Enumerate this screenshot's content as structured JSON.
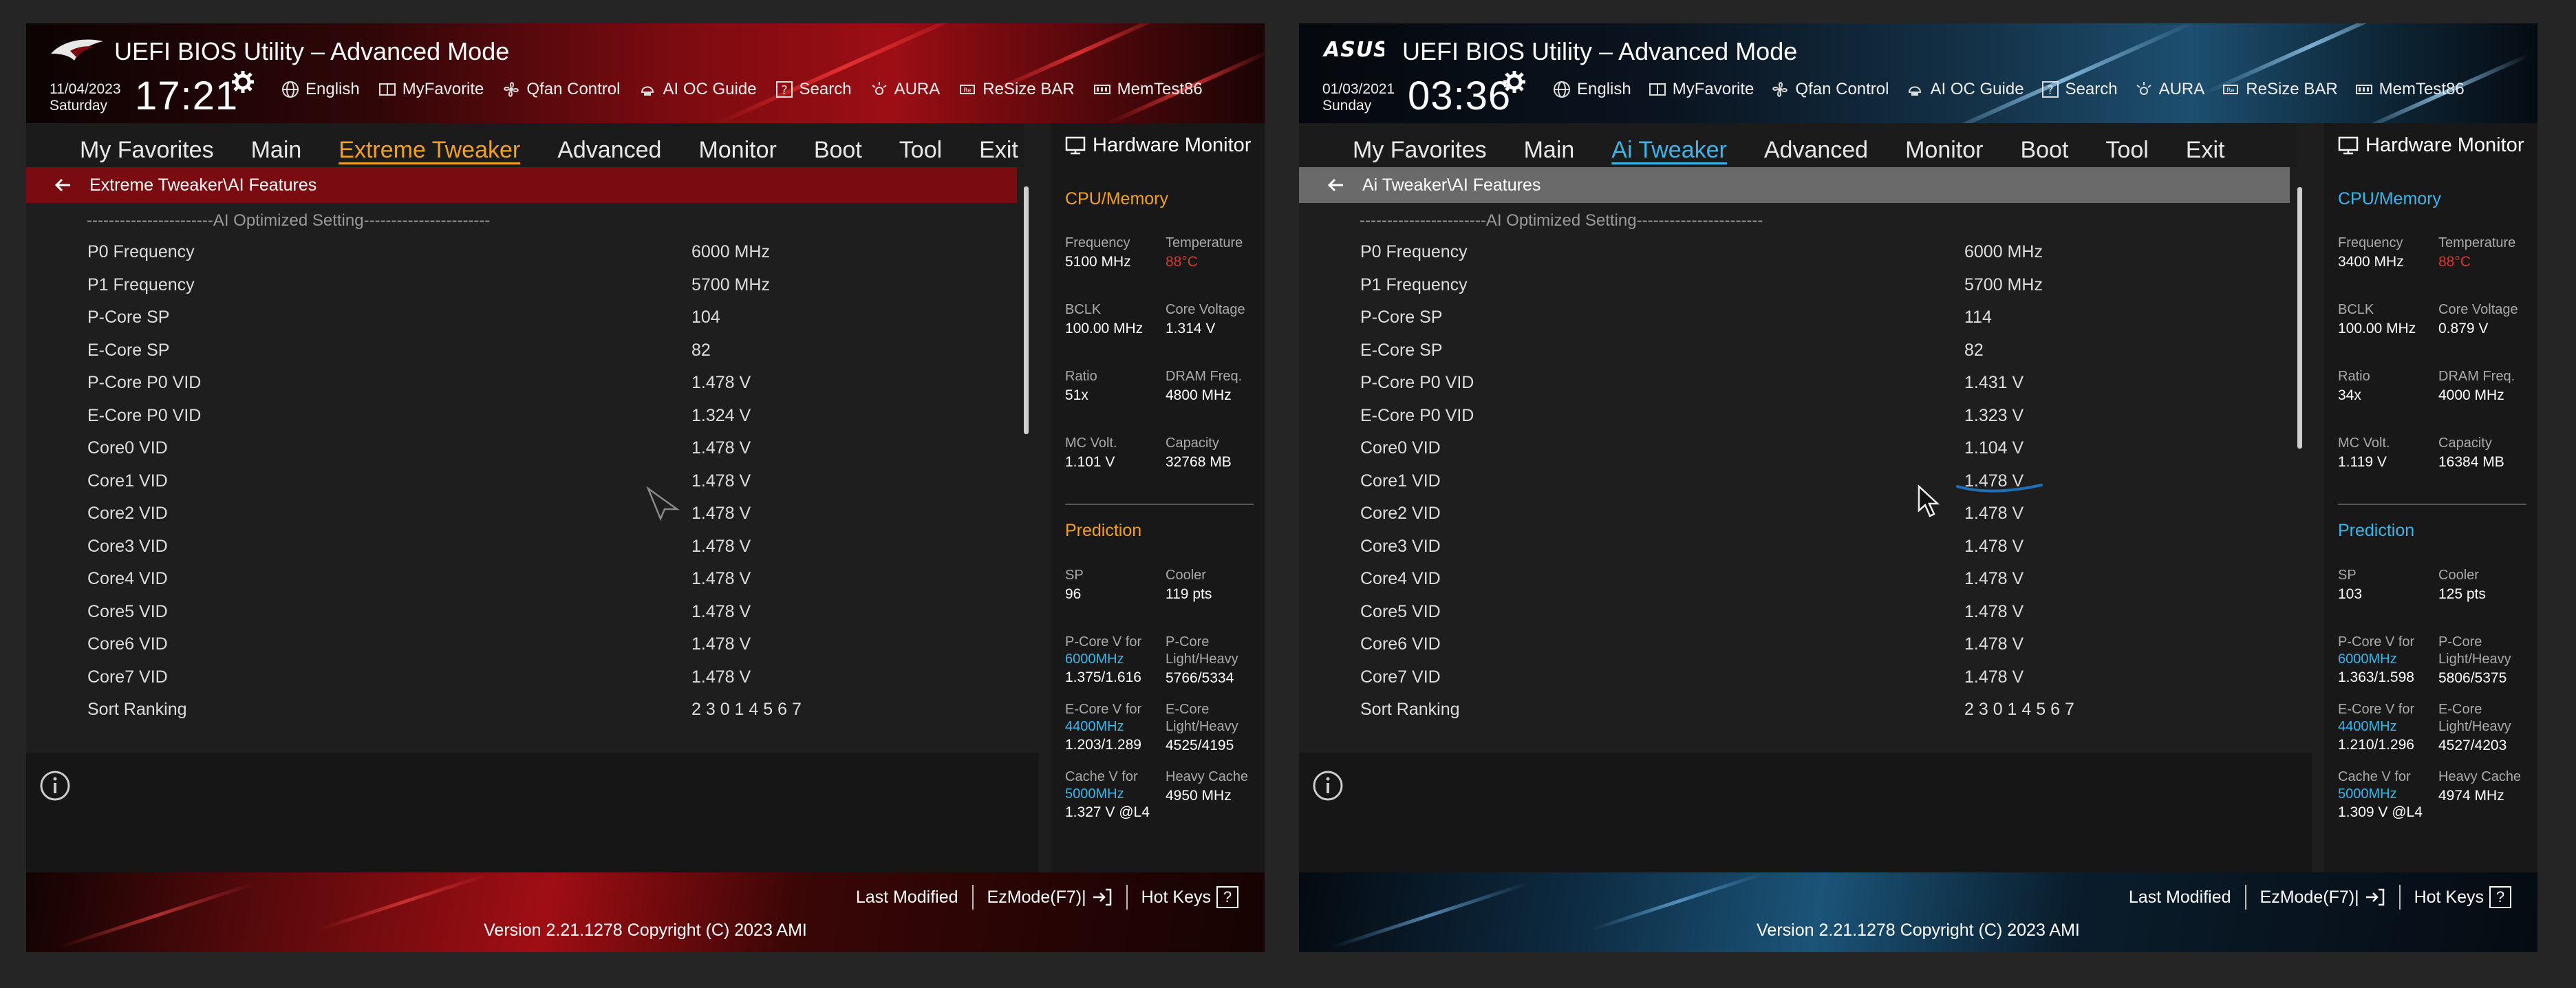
{
  "panels": [
    {
      "title": "UEFI BIOS Utility – Advanced Mode",
      "date": "11/04/2023",
      "day": "Saturday",
      "time": "17:21",
      "toolbar": [
        "English",
        "MyFavorite",
        "Qfan Control",
        "AI OC Guide",
        "Search",
        "AURA",
        "ReSize BAR",
        "MemTest86"
      ],
      "tabs": [
        "My Favorites",
        "Main",
        "Extreme Tweaker",
        "Advanced",
        "Monitor",
        "Boot",
        "Tool",
        "Exit"
      ],
      "active_tab": "Extreme Tweaker",
      "breadcrumb": "Extreme Tweaker\\AI Features",
      "divider": "-----------------------AI Optimized Setting-----------------------",
      "rows": [
        {
          "label": "P0 Frequency",
          "value": "6000 MHz"
        },
        {
          "label": "P1 Frequency",
          "value": "5700 MHz"
        },
        {
          "label": "P-Core SP",
          "value": "104"
        },
        {
          "label": "E-Core SP",
          "value": "82"
        },
        {
          "label": "P-Core P0 VID",
          "value": "1.478 V"
        },
        {
          "label": "E-Core P0 VID",
          "value": "1.324 V"
        },
        {
          "label": "Core0 VID",
          "value": "1.478 V"
        },
        {
          "label": "Core1 VID",
          "value": "1.478 V"
        },
        {
          "label": "Core2 VID",
          "value": "1.478 V"
        },
        {
          "label": "Core3 VID",
          "value": "1.478 V"
        },
        {
          "label": "Core4 VID",
          "value": "1.478 V"
        },
        {
          "label": "Core5 VID",
          "value": "1.478 V"
        },
        {
          "label": "Core6 VID",
          "value": "1.478 V"
        },
        {
          "label": "Core7 VID",
          "value": "1.478 V"
        },
        {
          "label": "Sort Ranking",
          "value": "2 3 0 1 4 5 6 7"
        }
      ],
      "hw_title": "Hardware Monitor",
      "hw_section_cpu": "CPU/Memory",
      "hw": {
        "frequency_label": "Frequency",
        "frequency": "5100 MHz",
        "temperature_label": "Temperature",
        "temperature": "88°C",
        "bclk_label": "BCLK",
        "bclk": "100.00 MHz",
        "core_voltage_label": "Core Voltage",
        "core_voltage": "1.314 V",
        "ratio_label": "Ratio",
        "ratio": "51x",
        "dram_label": "DRAM Freq.",
        "dram": "4800 MHz",
        "mc_volt_label": "MC Volt.",
        "mc_volt": "1.101 V",
        "capacity_label": "Capacity",
        "capacity": "32768 MB"
      },
      "hw_section_pred": "Prediction",
      "pred": {
        "sp_label": "SP",
        "sp": "96",
        "cooler_label": "Cooler",
        "cooler": "119 pts",
        "pcore_v_label": "P-Core V for",
        "pcore_v_freq": "6000MHz",
        "pcore_v": "1.375/1.616",
        "pcore_lh_label": "P-Core Light/Heavy",
        "pcore_lh": "5766/5334",
        "ecore_v_label": "E-Core V for",
        "ecore_v_freq": "4400MHz",
        "ecore_v": "1.203/1.289",
        "ecore_lh_label": "E-Core Light/Heavy",
        "ecore_lh": "4525/4195",
        "cache_v_label": "Cache V for",
        "cache_v_freq": "5000MHz",
        "cache_v": "1.327 V @L4",
        "heavy_cache_label": "Heavy Cache",
        "heavy_cache": "4950 MHz"
      },
      "footer": {
        "last_modified": "Last Modified",
        "ezmode": "EzMode(F7)|",
        "hotkeys": "Hot Keys",
        "hotkeys_key": "?",
        "version": "Version 2.21.1278 Copyright (C) 2023 AMI"
      },
      "accent": "#f2a11e",
      "theme": "red"
    },
    {
      "title": "UEFI BIOS Utility – Advanced Mode",
      "date": "01/03/2021",
      "day": "Sunday",
      "time": "03:36",
      "toolbar": [
        "English",
        "MyFavorite",
        "Qfan Control",
        "AI OC Guide",
        "Search",
        "AURA",
        "ReSize BAR",
        "MemTest86"
      ],
      "tabs": [
        "My Favorites",
        "Main",
        "Ai Tweaker",
        "Advanced",
        "Monitor",
        "Boot",
        "Tool",
        "Exit"
      ],
      "active_tab": "Ai Tweaker",
      "breadcrumb": "Ai Tweaker\\AI Features",
      "divider": "-----------------------AI Optimized Setting-----------------------",
      "rows": [
        {
          "label": "P0 Frequency",
          "value": "6000 MHz"
        },
        {
          "label": "P1 Frequency",
          "value": "5700 MHz"
        },
        {
          "label": "P-Core SP",
          "value": "114"
        },
        {
          "label": "E-Core SP",
          "value": "82"
        },
        {
          "label": "P-Core P0 VID",
          "value": "1.431 V"
        },
        {
          "label": "E-Core P0 VID",
          "value": "1.323 V"
        },
        {
          "label": "Core0 VID",
          "value": "1.104 V"
        },
        {
          "label": "Core1 VID",
          "value": "1.478 V"
        },
        {
          "label": "Core2 VID",
          "value": "1.478 V"
        },
        {
          "label": "Core3 VID",
          "value": "1.478 V"
        },
        {
          "label": "Core4 VID",
          "value": "1.478 V"
        },
        {
          "label": "Core5 VID",
          "value": "1.478 V"
        },
        {
          "label": "Core6 VID",
          "value": "1.478 V"
        },
        {
          "label": "Core7 VID",
          "value": "1.478 V"
        },
        {
          "label": "Sort Ranking",
          "value": "2 3 0 1 4 5 6 7"
        }
      ],
      "hw_title": "Hardware Monitor",
      "hw_section_cpu": "CPU/Memory",
      "hw": {
        "frequency_label": "Frequency",
        "frequency": "3400 MHz",
        "temperature_label": "Temperature",
        "temperature": "88°C",
        "bclk_label": "BCLK",
        "bclk": "100.00 MHz",
        "core_voltage_label": "Core Voltage",
        "core_voltage": "0.879 V",
        "ratio_label": "Ratio",
        "ratio": "34x",
        "dram_label": "DRAM Freq.",
        "dram": "4000 MHz",
        "mc_volt_label": "MC Volt.",
        "mc_volt": "1.119 V",
        "capacity_label": "Capacity",
        "capacity": "16384 MB"
      },
      "hw_section_pred": "Prediction",
      "pred": {
        "sp_label": "SP",
        "sp": "103",
        "cooler_label": "Cooler",
        "cooler": "125 pts",
        "pcore_v_label": "P-Core V for",
        "pcore_v_freq": "6000MHz",
        "pcore_v": "1.363/1.598",
        "pcore_lh_label": "P-Core Light/Heavy",
        "pcore_lh": "5806/5375",
        "ecore_v_label": "E-Core V for",
        "ecore_v_freq": "4400MHz",
        "ecore_v": "1.210/1.296",
        "ecore_lh_label": "E-Core Light/Heavy",
        "ecore_lh": "4527/4203",
        "cache_v_label": "Cache V for",
        "cache_v_freq": "5000MHz",
        "cache_v": "1.309 V @L4",
        "heavy_cache_label": "Heavy Cache",
        "heavy_cache": "4974 MHz"
      },
      "footer": {
        "last_modified": "Last Modified",
        "ezmode": "EzMode(F7)|",
        "hotkeys": "Hot Keys",
        "hotkeys_key": "?",
        "version": "Version 2.21.1278 Copyright (C) 2023 AMI"
      },
      "accent": "#3bb6ec",
      "theme": "blue"
    }
  ],
  "icons": {
    "logo_left": "rog-eye-logo",
    "logo_right": "asus-logo",
    "gear": "gear-icon",
    "toolbar": [
      "globe-icon",
      "favorite-icon",
      "fan-icon",
      "ai-guide-icon",
      "search-icon",
      "aura-icon",
      "resize-bar-icon",
      "memtest-icon"
    ]
  },
  "colors": {
    "temp_hot": "#e03434",
    "freq_link": "#3bb6ec",
    "annotation": "#1e6fb8"
  }
}
